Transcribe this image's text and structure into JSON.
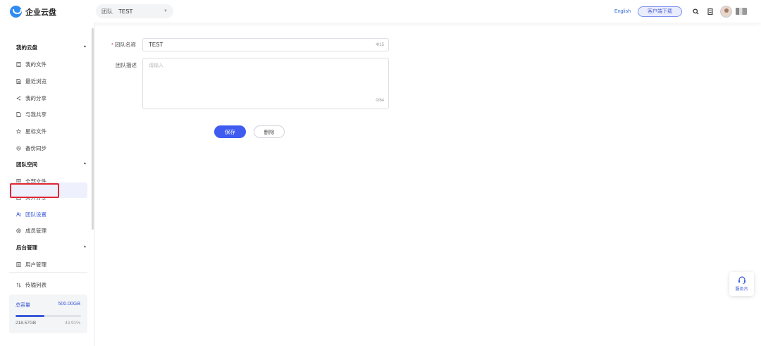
{
  "header": {
    "app_name": "企业云盘",
    "team_label": "团队",
    "team_value": "TEST",
    "language_link": "English",
    "client_download": "客户端下载"
  },
  "sidebar": {
    "my_cloud": "我的云盘",
    "my_cloud_items": [
      "我的文件",
      "最近浏览",
      "我的分享",
      "与我共享",
      "星标文件",
      "备份同步"
    ],
    "team_space": "团队空间",
    "team_items": [
      "全部文件",
      "对外分享",
      "团队设置",
      "成员管理"
    ],
    "admin": "后台管理",
    "admin_items": [
      "用户管理"
    ],
    "transfer_list": "传输列表",
    "storage": {
      "total_label": "总容量",
      "total_value": "500.00GB",
      "used_value": "218.57GB",
      "percent": "43.91%",
      "fill_fraction": 0.4391
    }
  },
  "form": {
    "name_label": "团队名称",
    "name_value": "TEST",
    "name_counter": "4/15",
    "desc_label": "团队描述",
    "desc_placeholder": "请输入",
    "desc_counter": "0/64",
    "save_button": "保存",
    "delete_button": "删除"
  },
  "service_widget": {
    "label": "服务台"
  },
  "colors": {
    "accent": "#3f5bf0",
    "highlight": "#e02833"
  }
}
